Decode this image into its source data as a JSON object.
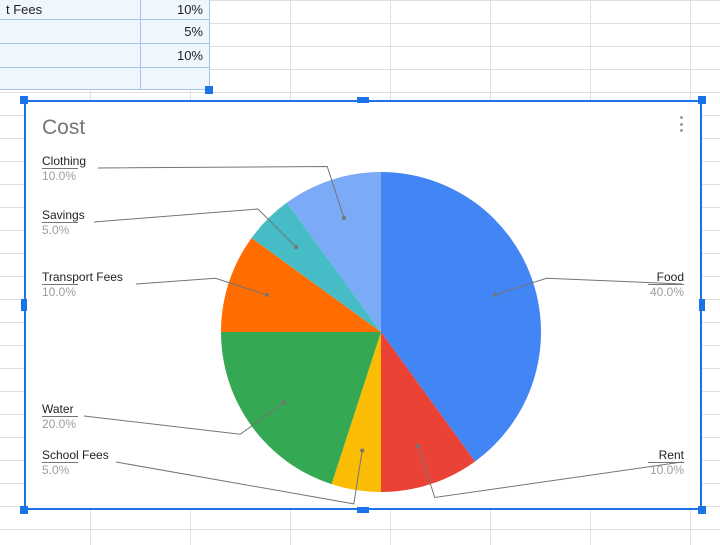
{
  "table": {
    "rows": [
      {
        "label": "t Fees",
        "value": "10%"
      },
      {
        "label": "",
        "value": "5%"
      },
      {
        "label": "",
        "value": "10%"
      }
    ]
  },
  "chart": {
    "title": "Cost",
    "menu_name": "chart-overflow-menu"
  },
  "chart_data": {
    "type": "pie",
    "title": "Cost",
    "series": [
      {
        "name": "Food",
        "value": 40.0,
        "color": "#4285f4"
      },
      {
        "name": "Rent",
        "value": 10.0,
        "color": "#ea4335"
      },
      {
        "name": "School Fees",
        "value": 5.0,
        "color": "#fbbc04"
      },
      {
        "name": "Water",
        "value": 20.0,
        "color": "#34a853"
      },
      {
        "name": "Transport Fees",
        "value": 10.0,
        "color": "#ff6d01"
      },
      {
        "name": "Savings",
        "value": 5.0,
        "color": "#46bdc6"
      },
      {
        "name": "Clothing",
        "value": 10.0,
        "color": "#7baaf7"
      }
    ],
    "labels": {
      "Food": {
        "text": "Food",
        "pct": "40.0%"
      },
      "Rent": {
        "text": "Rent",
        "pct": "10.0%"
      },
      "School Fees": {
        "text": "School Fees",
        "pct": "5.0%"
      },
      "Water": {
        "text": "Water",
        "pct": "20.0%"
      },
      "Transport Fees": {
        "text": "Transport Fees",
        "pct": "10.0%"
      },
      "Savings": {
        "text": "Savings",
        "pct": "5.0%"
      },
      "Clothing": {
        "text": "Clothing",
        "pct": "10.0%"
      }
    }
  }
}
